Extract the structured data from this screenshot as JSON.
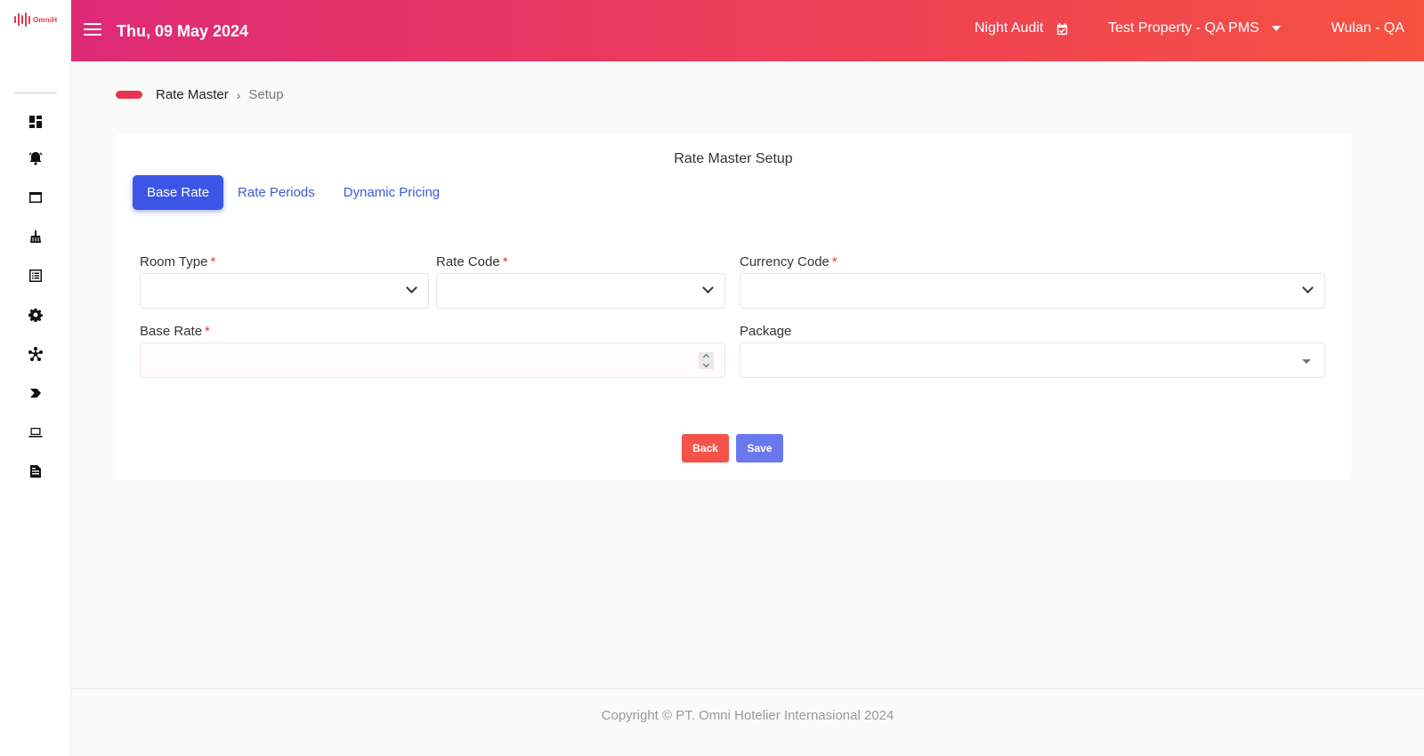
{
  "brand": {
    "logo_text": "OmniH",
    "accent_color": "#e8344e"
  },
  "header": {
    "date": "Thu, 09 May 2024",
    "night_audit_label": "Night Audit",
    "property": "Test Property - QA PMS",
    "user": "Wulan - QA",
    "gradient": [
      "#de2a77",
      "#f65142"
    ]
  },
  "sidebar": {
    "items": [
      {
        "icon": "dashboard-icon"
      },
      {
        "icon": "bell-icon"
      },
      {
        "icon": "window-icon"
      },
      {
        "icon": "broom-icon"
      },
      {
        "icon": "list-icon"
      },
      {
        "icon": "gear-icon"
      },
      {
        "icon": "network-icon"
      },
      {
        "icon": "chevron-tag-icon"
      },
      {
        "icon": "laptop-icon"
      },
      {
        "icon": "document-icon"
      }
    ]
  },
  "breadcrumb": {
    "parent": "Rate Master",
    "separator": "›",
    "current": "Setup"
  },
  "card": {
    "title": "Rate Master Setup",
    "tabs": [
      {
        "label": "Base Rate",
        "active": true
      },
      {
        "label": "Rate Periods",
        "active": false
      },
      {
        "label": "Dynamic Pricing",
        "active": false
      }
    ]
  },
  "form": {
    "room_type": {
      "label": "Room Type",
      "required_mark": "*",
      "value": ""
    },
    "rate_code": {
      "label": "Rate Code",
      "required_mark": "*",
      "value": ""
    },
    "currency_code": {
      "label": "Currency Code",
      "required_mark": "*",
      "value": ""
    },
    "base_rate": {
      "label": "Base Rate",
      "required_mark": "*",
      "value": ""
    },
    "package": {
      "label": "Package",
      "value": ""
    }
  },
  "buttons": {
    "back": "Back",
    "save": "Save",
    "back_color": "#f5534a",
    "save_color": "#6a78ee"
  },
  "footer": {
    "copyright": "Copyright © PT. Omni Hotelier Internasional 2024"
  }
}
